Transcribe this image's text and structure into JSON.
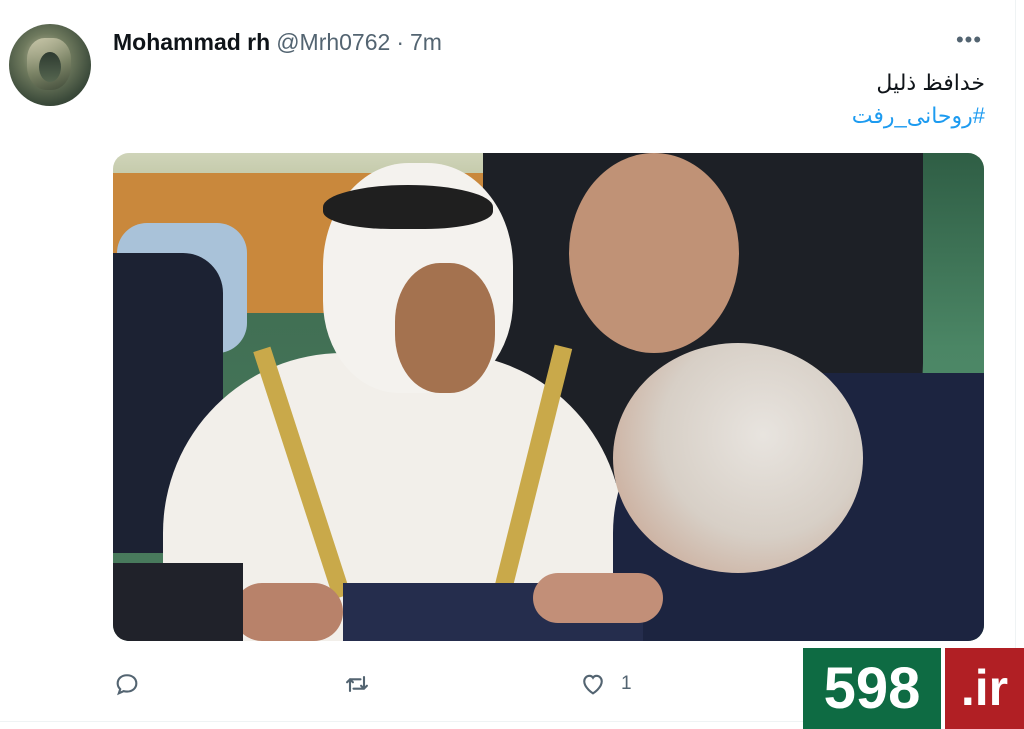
{
  "tweet": {
    "author_name": "Mohammad rh",
    "handle": "@Mrh0762",
    "separator": "·",
    "time": "7m",
    "more_label": "•••",
    "text_line1": "خدافظ ذلیل",
    "hashtag": "#روحانی_رفت"
  },
  "actions": {
    "reply": {
      "icon": "reply-icon",
      "count": ""
    },
    "retweet": {
      "icon": "retweet-icon",
      "count": ""
    },
    "like": {
      "icon": "heart-icon",
      "count": "1"
    }
  },
  "watermark": {
    "number": "598",
    "tld": ".ir",
    "colors": {
      "green": "#0e6b43",
      "red": "#b11f24"
    }
  },
  "colors": {
    "link": "#1d9bf0",
    "muted": "#536471",
    "text": "#0f1419"
  }
}
